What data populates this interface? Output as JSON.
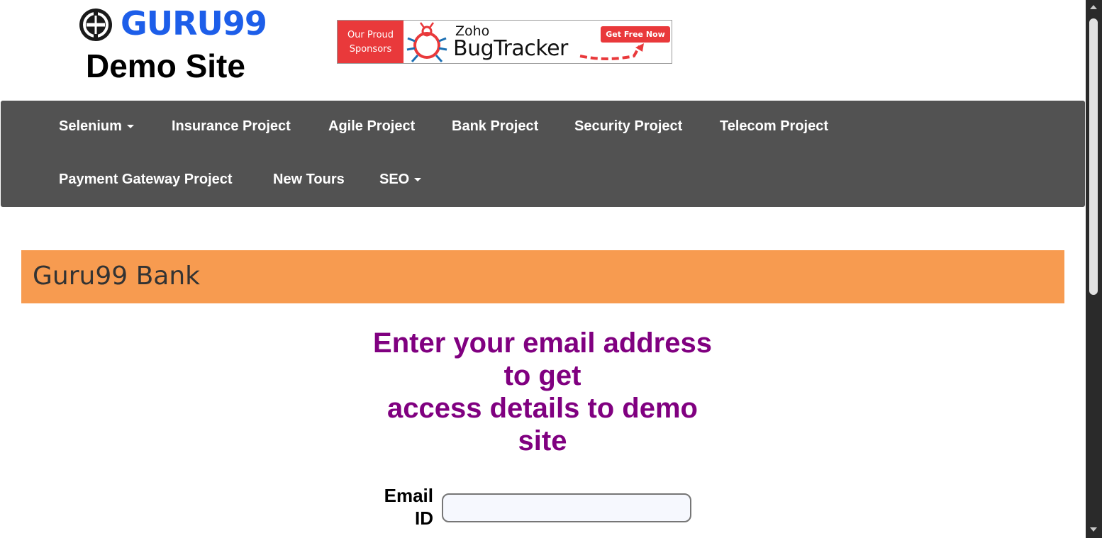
{
  "header": {
    "logo_text": "GURU99",
    "subtitle": "Demo Site"
  },
  "banner": {
    "left_line1": "Our Proud",
    "left_line2": "Sponsors",
    "brand": "Zoho",
    "product": "BugTracker",
    "cta": "Get Free Now"
  },
  "nav": {
    "items": [
      {
        "label": "Selenium",
        "dropdown": true
      },
      {
        "label": "Insurance Project"
      },
      {
        "label": "Agile Project"
      },
      {
        "label": "Bank Project"
      },
      {
        "label": "Security Project"
      },
      {
        "label": "Telecom Project"
      },
      {
        "label": "Payment Gateway Project"
      },
      {
        "label": "New Tours"
      },
      {
        "label": "SEO",
        "dropdown": true
      }
    ]
  },
  "main": {
    "title": "Guru99 Bank",
    "heading_lines": [
      "Enter your email address",
      "to get",
      "access details to demo",
      "site"
    ],
    "email_label_line1": "Email",
    "email_label_line2": "ID",
    "email_value": ""
  },
  "colors": {
    "nav_bg": "#525252",
    "title_bar": "#f79b50",
    "heading": "#800080",
    "logo": "#1d5ee9",
    "banner_red": "#e9393b"
  }
}
